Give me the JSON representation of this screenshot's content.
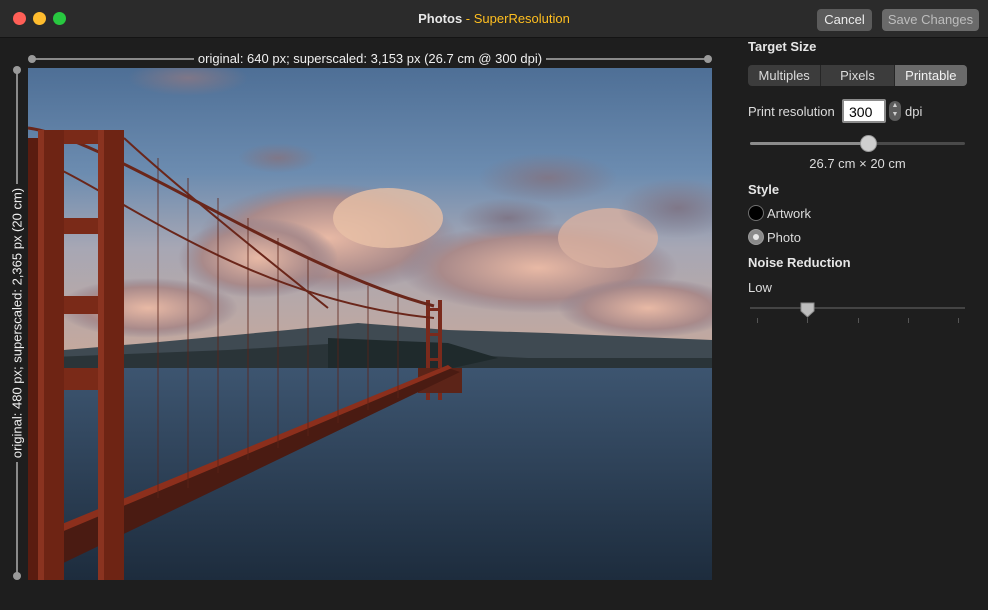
{
  "window": {
    "app_name": "Photos",
    "separator": " - ",
    "extension_name": "SuperResolution",
    "cancel_label": "Cancel",
    "save_label": "Save Changes"
  },
  "image": {
    "width_label": "original: 640 px; superscaled: 3,153 px (26.7 cm @ 300 dpi)",
    "height_label": "original: 480 px; superscaled: 2,365 px (20 cm)"
  },
  "sidebar": {
    "target_size_title": "Target Size",
    "tabs": [
      {
        "label": "Multiples",
        "active": false
      },
      {
        "label": "Pixels",
        "active": false
      },
      {
        "label": "Printable",
        "active": true
      }
    ],
    "print_resolution_label": "Print resolution",
    "print_resolution_value": "300",
    "dpi_label": "dpi",
    "resolution_slider_fraction": 0.55,
    "dimensions_text": "26.7 cm × 20 cm",
    "style_title": "Style",
    "style_options": [
      {
        "label": "Artwork",
        "selected": false
      },
      {
        "label": "Photo",
        "selected": true
      }
    ],
    "noise_title": "Noise Reduction",
    "noise_value_label": "Low",
    "noise_level_fraction": 0.25
  },
  "colors": {
    "accent_extension": "#ffbf20",
    "close": "#ff5f57",
    "minimize": "#febc2e",
    "maximize": "#28c840"
  }
}
